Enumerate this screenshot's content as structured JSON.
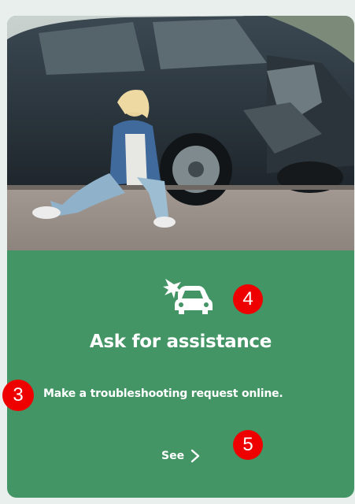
{
  "card": {
    "image_alt": "Woman sitting on the road next to a damaged car",
    "icon": "car-crash-icon",
    "title": "Ask for assistance",
    "description": "Make a troubleshooting request online.",
    "link_label": "See",
    "link_icon": "chevron-right-icon"
  },
  "annotations": [
    {
      "label": "3"
    },
    {
      "label": "4"
    },
    {
      "label": "5"
    }
  ],
  "colors": {
    "card_green": "#449565",
    "badge_red": "#ee0000",
    "text": "#ffffff"
  }
}
